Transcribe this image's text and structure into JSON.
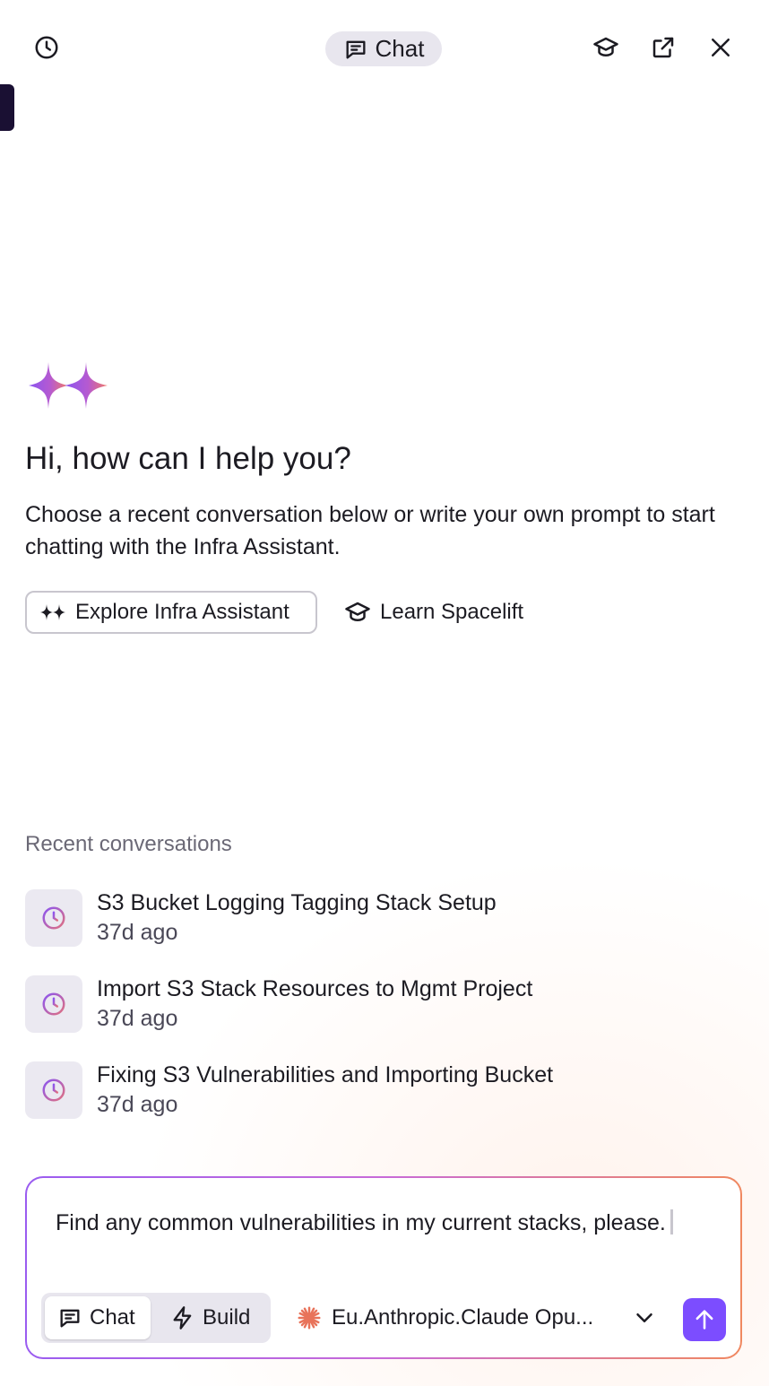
{
  "header": {
    "history_icon": "clock-icon",
    "mode_label": "Chat",
    "mode_icon": "chat-bubble-icon",
    "learn_icon": "graduation-cap-icon",
    "popout_icon": "external-link-icon",
    "close_icon": "close-icon"
  },
  "welcome": {
    "title": "Hi, how can I help you?",
    "subtitle": "Choose a recent conversation below or write your own prompt to start chatting with the Infra Assistant.",
    "explore_label": "Explore Infra Assistant",
    "learn_label": "Learn Spacelift"
  },
  "recent": {
    "heading": "Recent conversations",
    "items": [
      {
        "title": "S3 Bucket Logging Tagging Stack Setup",
        "time": "37d ago"
      },
      {
        "title": "Import S3 Stack Resources to Mgmt Project",
        "time": "37d ago"
      },
      {
        "title": "Fixing S3 Vulnerabilities and Importing Bucket",
        "time": "37d ago"
      }
    ]
  },
  "composer": {
    "input_value": "Find any common vulnerabilities in my current stacks, please.",
    "modes": [
      {
        "label": "Chat",
        "active": true
      },
      {
        "label": "Build",
        "active": false
      }
    ],
    "model_label": "Eu.Anthropic.Claude Opu...",
    "send_icon": "arrow-up-icon"
  },
  "colors": {
    "accent": "#7c4dff",
    "pill_bg": "#e8e6ee",
    "border_gradient_start": "#9a5cf0",
    "border_gradient_end": "#f08860",
    "model_logo": "#e8735a"
  }
}
